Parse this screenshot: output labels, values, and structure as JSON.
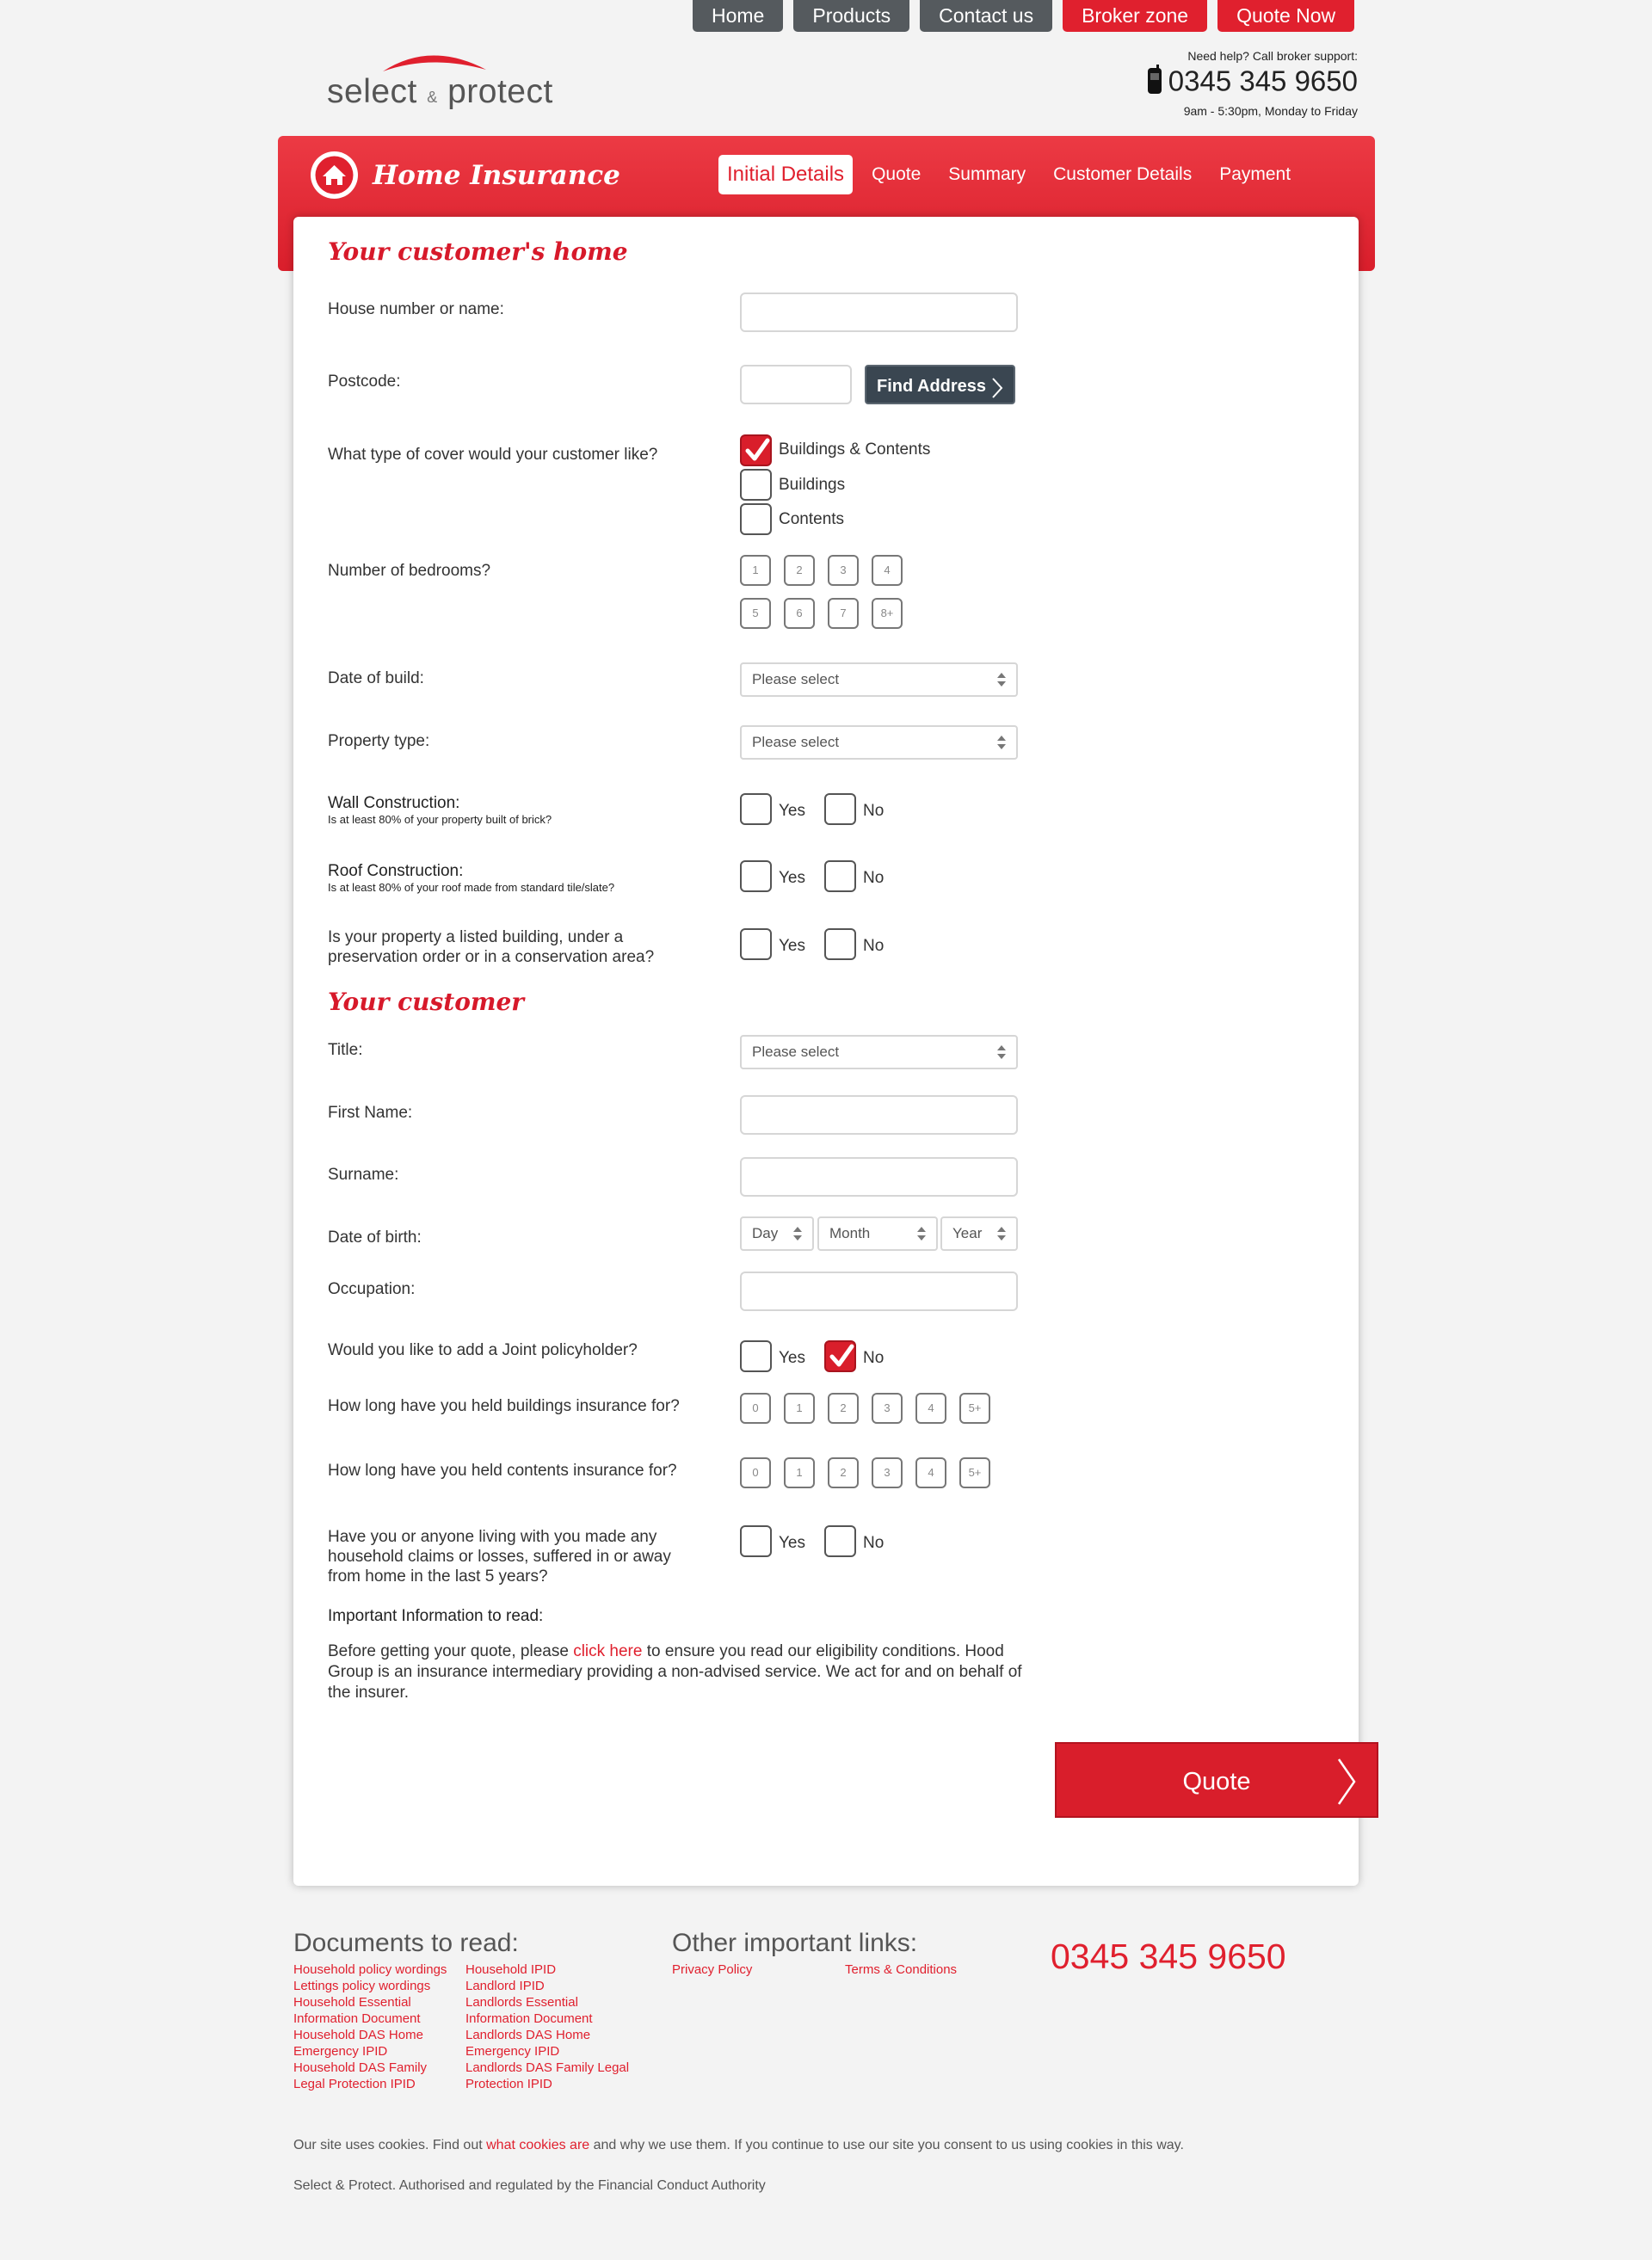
{
  "nav": {
    "home": "Home",
    "products": "Products",
    "contact": "Contact us",
    "broker": "Broker zone",
    "quote_now": "Quote Now"
  },
  "logo": {
    "select": "select",
    "amp": "&",
    "protect": "protect"
  },
  "help": {
    "line1": "Need help? Call broker support:",
    "phone": "0345 345 9650",
    "hours": "9am - 5:30pm, Monday to Friday"
  },
  "header": {
    "title": "Home Insurance",
    "steps": [
      "Initial Details",
      "Quote",
      "Summary",
      "Customer Details",
      "Payment"
    ]
  },
  "form": {
    "section1": "Your customer's home",
    "house_label": "House number or name:",
    "postcode_label": "Postcode:",
    "find_address": "Find Address",
    "cover_label": "What type of cover would your customer like?",
    "cover_options": [
      "Buildings & Contents",
      "Buildings",
      "Contents"
    ],
    "bedrooms_label": "Number of bedrooms?",
    "bedrooms": [
      "1",
      "2",
      "3",
      "4",
      "5",
      "6",
      "7",
      "8+"
    ],
    "build_label": "Date of build:",
    "property_label": "Property type:",
    "please_select": "Please select",
    "wall_label": "Wall Construction:",
    "wall_sub": "Is at least 80% of your property built of brick?",
    "roof_label": "Roof Construction:",
    "roof_sub": "Is at least 80% of your roof made from standard tile/slate?",
    "listed_label": "Is your property a listed building, under a preservation order or in a conservation area?",
    "yes": "Yes",
    "no": "No",
    "section2": "Your customer",
    "title_label": "Title:",
    "first_label": "First Name:",
    "surname_label": "Surname:",
    "dob_label": "Date of birth:",
    "dob_day": "Day",
    "dob_month": "Month",
    "dob_year": "Year",
    "occupation_label": "Occupation:",
    "joint_label": "Would you like to add a Joint policyholder?",
    "buildings_years_label": "How long have you held buildings insurance for?",
    "contents_years_label": "How long have you held contents insurance for?",
    "years": [
      "0",
      "1",
      "2",
      "3",
      "4",
      "5+"
    ],
    "claims_label": "Have you or anyone living with you made any household claims or losses, suffered in or away from home in the last 5 years?",
    "info_head": "Important Information to read:",
    "info_pre": "Before getting your quote, please ",
    "info_link": "click here",
    "info_post": " to ensure you read our eligibility conditions. Hood Group is an insurance intermediary providing a non-advised service. We act for and on behalf of the insurer.",
    "quote_button": "Quote"
  },
  "footer": {
    "docs_head": "Documents to read:",
    "docs_col1": [
      "Household policy wordings",
      "Lettings policy wordings",
      "Household Essential",
      "Information Document",
      "Household DAS Home",
      "Emergency IPID",
      "Household DAS Family",
      "Legal Protection IPID"
    ],
    "docs_col2": [
      "Household IPID",
      "Landlord IPID",
      "Landlords Essential",
      "Information Document",
      "Landlords DAS Home",
      "Emergency IPID",
      "Landlords DAS Family Legal",
      "Protection IPID"
    ],
    "links_head": "Other important links:",
    "privacy": "Privacy Policy",
    "terms": "Terms & Conditions",
    "phone": "0345 345 9650",
    "cookies_pre": "Our site uses cookies. Find out ",
    "cookies_link": "what cookies are",
    "cookies_post": " and why we use them. If you continue to use our site you consent to us using cookies in this way.",
    "regulated": "Select & Protect. Authorised and regulated by the Financial Conduct Authority"
  },
  "colors": {
    "brand_red": "#e0202e",
    "nav_grey": "#555a5e",
    "button_dark": "#3a4651"
  },
  "state": {
    "cover_selected": "Buildings & Contents",
    "joint_policyholder": "No"
  }
}
